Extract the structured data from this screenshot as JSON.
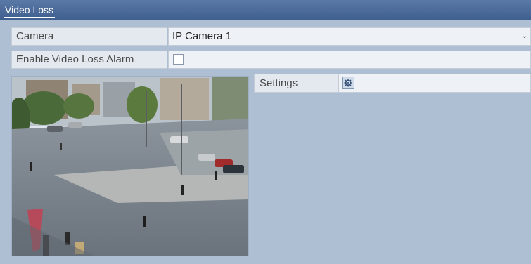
{
  "header": {
    "title": "Video Loss"
  },
  "camera": {
    "label": "Camera",
    "value": "IP Camera 1",
    "icon": "chevron-down-icon"
  },
  "alarm": {
    "label": "Enable Video Loss Alarm",
    "checked": false
  },
  "settings": {
    "label": "Settings",
    "icon": "gear-icon"
  },
  "colors": {
    "titlebar": "#3f5f8f",
    "background": "#aebfd3",
    "panel": "#eef2f6"
  }
}
